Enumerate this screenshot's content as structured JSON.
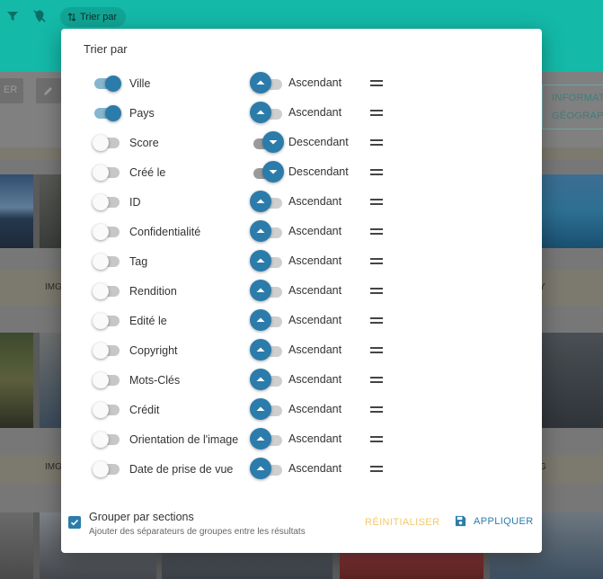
{
  "topbar": {
    "sort_chip_label": "Trier par",
    "filter_icon": "filter-icon",
    "place_icon": "location-off-icon"
  },
  "toolbar": {
    "partial_button_label": "ER",
    "info_button_line1": "INFORMAT",
    "info_button_line2": "GÉOGRAPH"
  },
  "background": {
    "captions": [
      "IMG",
      "IMG",
      "Y",
      "G"
    ]
  },
  "dialog": {
    "title": "Trier par",
    "rows": [
      {
        "label": "Ville",
        "enabled": true,
        "direction": "Ascendant"
      },
      {
        "label": "Pays",
        "enabled": true,
        "direction": "Ascendant"
      },
      {
        "label": "Score",
        "enabled": false,
        "direction": "Descendant"
      },
      {
        "label": "Créé le",
        "enabled": false,
        "direction": "Descendant"
      },
      {
        "label": "ID",
        "enabled": false,
        "direction": "Ascendant"
      },
      {
        "label": "Confidentialité",
        "enabled": false,
        "direction": "Ascendant"
      },
      {
        "label": "Tag",
        "enabled": false,
        "direction": "Ascendant"
      },
      {
        "label": "Rendition",
        "enabled": false,
        "direction": "Ascendant"
      },
      {
        "label": "Edité le",
        "enabled": false,
        "direction": "Ascendant"
      },
      {
        "label": "Copyright",
        "enabled": false,
        "direction": "Ascendant"
      },
      {
        "label": "Mots-Clés",
        "enabled": false,
        "direction": "Ascendant"
      },
      {
        "label": "Crédit",
        "enabled": false,
        "direction": "Ascendant"
      },
      {
        "label": "Orientation de l'image",
        "enabled": false,
        "direction": "Ascendant"
      },
      {
        "label": "Date de prise de vue",
        "enabled": false,
        "direction": "Ascendant"
      }
    ],
    "group": {
      "checked": true,
      "title": "Grouper par sections",
      "subtitle": "Ajouter des séparateurs de groupes entre les résultats"
    },
    "reset_label": "RÉINITIALISER",
    "apply_label": "APPLIQUER"
  },
  "colors": {
    "accent": "#2b7cab",
    "topbar": "#14b9a8",
    "reset": "#f3c96b"
  }
}
